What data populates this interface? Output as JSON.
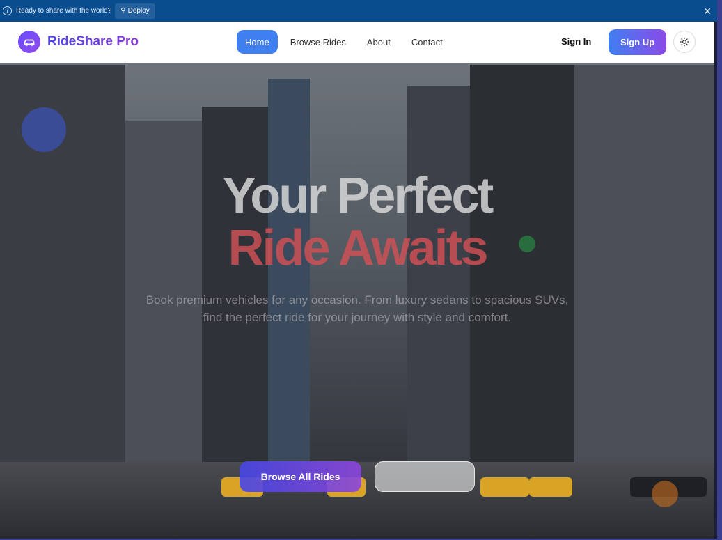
{
  "banner": {
    "message": "Ready to share with the world?",
    "deploy_label": "Deploy",
    "close_glyph": "✕"
  },
  "nav": {
    "brand": "RideShare Pro",
    "links": [
      {
        "label": "Home",
        "active": true
      },
      {
        "label": "Browse Rides",
        "active": false
      },
      {
        "label": "About",
        "active": false
      },
      {
        "label": "Contact",
        "active": false
      }
    ],
    "signin": "Sign In",
    "signup": "Sign Up"
  },
  "hero": {
    "title_line1": "Your Perfect",
    "title_line2": "Ride Awaits",
    "subtitle": "Book premium vehicles for any occasion. From luxury sedans to spacious SUVs, find the perfect ride for your journey with style and comfort.",
    "primary_button": "Browse All Rides",
    "secondary_button": ""
  },
  "colors": {
    "banner_bg": "#0a4d8e",
    "accent_blue": "#3f7ff0",
    "accent_purple": "#8b4be6",
    "title_red": "#d25055"
  },
  "icons": {
    "banner_info": "info-icon",
    "deploy": "rocket-icon",
    "close": "close-icon",
    "logo": "car-icon",
    "theme": "sun-icon"
  }
}
